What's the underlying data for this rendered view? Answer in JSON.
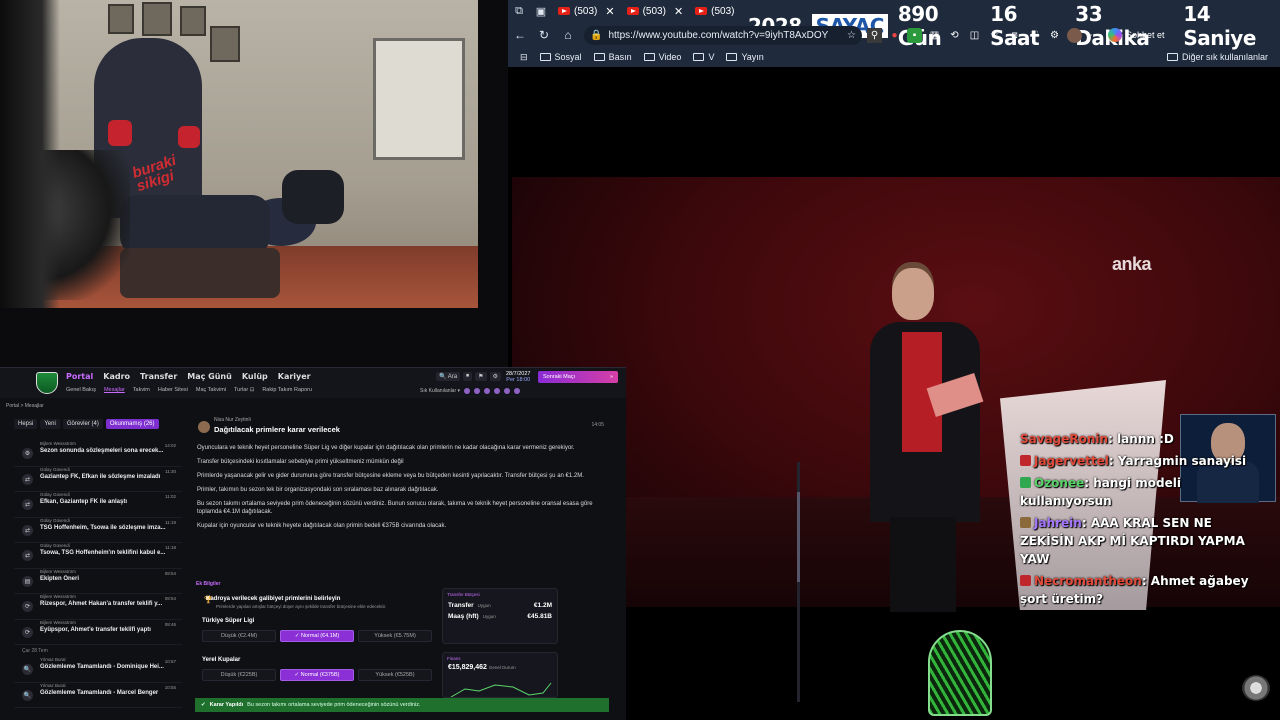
{
  "counter": {
    "year": "2028",
    "label": "SAYAÇ",
    "days": "890 Gün",
    "hours": "16 Saat",
    "minutes": "33 Dakika",
    "seconds": "14 Saniye"
  },
  "browser": {
    "tabs": [
      {
        "label": "(503)"
      },
      {
        "label": "(503)"
      },
      {
        "label": "(503)"
      }
    ],
    "url": "https://www.youtube.com/watch?v=9iyhT8AxDOY",
    "chat_label": "Sohbet et",
    "bookmarks": [
      "Sosyal",
      "Basın",
      "Video",
      "V",
      "Yayın"
    ],
    "other_bookmarks": "Diğer sık kullanılanlar"
  },
  "video": {
    "watermark": "anka"
  },
  "webcam": {
    "brand": "buraki\nsikigi"
  },
  "chat": [
    {
      "user": "SavageRonin",
      "user_color": "#e24b3b",
      "text": "lannn :D",
      "badge_color": ""
    },
    {
      "user": "Jagervettel",
      "user_color": "#e24b3b",
      "text": "Yarragmin sanayisi",
      "badge_color": "#c0272d"
    },
    {
      "user": "Ozonee",
      "user_color": "#59d36a",
      "text": "hangi modeli kullanıyorsun",
      "badge_color": "#2fa84f"
    },
    {
      "user": "Jahrein",
      "user_color": "#a678ff",
      "text": "AAA KRAL SEN NE ZEKİSİN AKP Mİ KAPTIRDI YAPMA YAW",
      "badge_color": "#8a6a3a"
    },
    {
      "user": "Necromantheon",
      "user_color": "#e24b3b",
      "text": "Ahmet ağabey şort üretim?",
      "badge_color": "#c0272d"
    }
  ],
  "game": {
    "topnav": [
      "Portal",
      "Kadro",
      "Transfer",
      "Maç Günü",
      "Kulüp",
      "Kariyer"
    ],
    "subnav": [
      "Genel Bakış",
      "Mesajlar",
      "Takvim",
      "Haber Sitesi",
      "Maç Takvimi",
      "Turlar ⊡",
      "Rakip Takım Raporu"
    ],
    "tools": [
      "🔍 Ara",
      "⏹",
      "⚑",
      "⚙"
    ],
    "date": "28/7/2027",
    "day": "Per 18:00",
    "continue": "Sonraki Maçı",
    "fav": "Sık Kullanılanlar ▾",
    "crumb": "Portal > Mesajlar",
    "filters": [
      "Hepsi",
      "Yeni",
      "Görevler (4)",
      "Okunmamış (26)"
    ],
    "messages": [
      {
        "from": "Bijlem Wessström",
        "subject": "Sezon sonunda sözleşmeleri sona erecek...",
        "time": "14:02",
        "icon": "⚙"
      },
      {
        "from": "Gülay Güvendi",
        "subject": "Gaziantep FK, Efkan ile sözleşme imzaladı",
        "time": "11:30",
        "icon": "⇄"
      },
      {
        "from": "Gülay Güvendi",
        "subject": "Efkan, Gaziantep FK ile anlaştı",
        "time": "11:02",
        "icon": "⇄"
      },
      {
        "from": "Gülay Güvendi",
        "subject": "TSG Hoffenheim, Tsowa ile sözleşme imza...",
        "time": "11:19",
        "icon": "⇄"
      },
      {
        "from": "Gülay Güvendi",
        "subject": "Tsowa, TSG Hoffenheim'ın teklifini kabul e...",
        "time": "11:18",
        "icon": "⇄"
      },
      {
        "from": "Bijlem Wessström",
        "subject": "Ekipten Öneri",
        "time": "08:54",
        "icon": "▤"
      },
      {
        "from": "Bijlem Wessström",
        "subject": "Rizespor, Ahmet Hakan'a transfer teklifi y...",
        "time": "08:54",
        "icon": "⟳"
      },
      {
        "from": "Bijlem Wessström",
        "subject": "Eyüpspor, Ahmet'e transfer teklifi yaptı",
        "time": "08:46",
        "icon": "⟳"
      }
    ],
    "day_sep": "Çar 28 Tem",
    "messages2": [
      {
        "from": "Yılmaz Bural",
        "subject": "Gözlemleme Tamamlandı - Dominique Hei...",
        "time": "10:57",
        "icon": "🔍"
      },
      {
        "from": "Yılmaz Bural",
        "subject": "Gözlemleme Tamamlandı - Marcel Benger",
        "time": "10:55",
        "icon": "🔍"
      }
    ],
    "msg": {
      "from": "Nisa Nur Zeytinli",
      "title": "Dağıtılacak primlere karar verilecek",
      "time": "14:05",
      "paras": [
        "Oyunculara ve teknik heyet personeline Süper Lig ve diğer kupalar için dağıtılacak olan primlerin ne kadar olacağına karar vermeniz gerekiyor.",
        "Transfer bütçesindeki kısıtlamalar sebebiyle primi yükseltmeniz mümkün değil",
        "Primlerde yaşanacak gelir ve gider durumuna göre transfer bütçesine ekleme veya bu bütçeden kesinti yapılacaktır. Transfer bütçesi şu an €1.2M.",
        "Primler, takımın bu sezon tek bir organizasyondaki son sıralaması baz alınarak dağıtılacak.",
        "Bu sezon takımı ortalama seviyede prim ödeneceğinin sözünü verdiniz. Bunun sonucu olarak, takıma ve teknik heyet personeline oransal esasa göre toplamda €4.1M dağıtılacak.",
        "Kupalar için oyuncular ve teknik heyete dağıtılacak olan primin bedeli €375B civarında olacak."
      ],
      "ek": "Ek Bilgiler",
      "goal": "Kadroya verilecek galibiyet primlerini belirleyin",
      "goal_sub": "Primlerde yapılan artışlar bütçeyi düşer aynı şekilde transfer bütçesine ekle edecektir.",
      "league": "Türkiye Süper Ligi",
      "league_opts": [
        "Düşük (€2.4M)",
        "✓ Normal (€4.1M)",
        "Yüksek (€5.75M)"
      ],
      "cup": "Yerel Kupalar",
      "cup_opts": [
        "Düşük (€225B)",
        "✓ Normal (€375B)",
        "Yüksek (€525B)"
      ]
    },
    "transfer_box": {
      "head": "Transfer Bütçesi",
      "rows": [
        {
          "label": "Transfer",
          "sub": "Uygun",
          "value": "€1.2M"
        },
        {
          "label": "Maaş (hft)",
          "sub": "Uygun",
          "value": "€45.81B"
        }
      ]
    },
    "finance": {
      "head": "Finans",
      "value": "€15,829,462",
      "sub": "Genel Durum"
    },
    "toast": {
      "title": "Karar Yapıldı",
      "text": "Bu sezon takımı ortalama seviyede prim ödeneceğinin sözünü verdiniz."
    }
  }
}
